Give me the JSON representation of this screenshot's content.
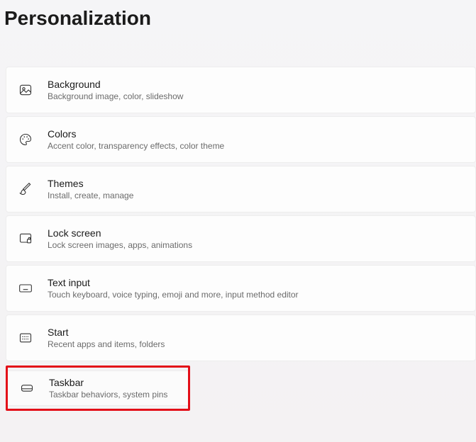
{
  "header": {
    "title": "Personalization"
  },
  "items": [
    {
      "title": "Background",
      "desc": "Background image, color, slideshow"
    },
    {
      "title": "Colors",
      "desc": "Accent color, transparency effects, color theme"
    },
    {
      "title": "Themes",
      "desc": "Install, create, manage"
    },
    {
      "title": "Lock screen",
      "desc": "Lock screen images, apps, animations"
    },
    {
      "title": "Text input",
      "desc": "Touch keyboard, voice typing, emoji and more, input method editor"
    },
    {
      "title": "Start",
      "desc": "Recent apps and items, folders"
    },
    {
      "title": "Taskbar",
      "desc": "Taskbar behaviors, system pins"
    }
  ]
}
